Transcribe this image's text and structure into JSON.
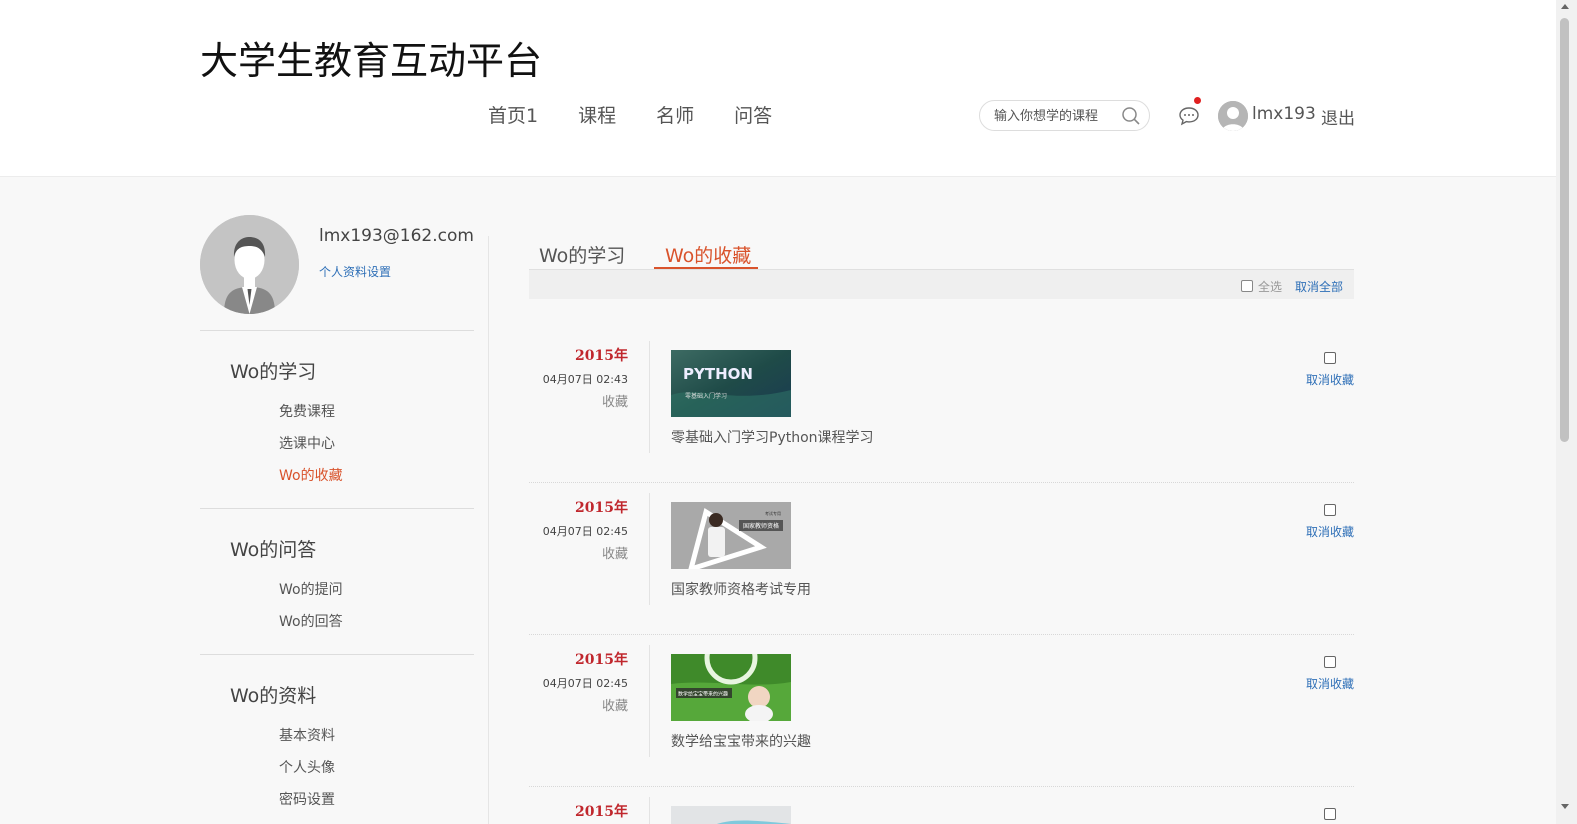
{
  "header": {
    "site_title": "大学生教育互动平台",
    "nav": [
      "首页1",
      "课程",
      "名师",
      "问答"
    ],
    "search_placeholder": "输入你想学的课程",
    "username": "lmx193",
    "logout": "退出"
  },
  "profile": {
    "email": "lmx193@162.com",
    "settings_link": "个人资料设置"
  },
  "sidebar": {
    "sections": [
      {
        "title": "Wo的学习",
        "items": [
          "免费课程",
          "选课中心",
          "Wo的收藏"
        ],
        "active_index": 2
      },
      {
        "title": "Wo的问答",
        "items": [
          "Wo的提问",
          "Wo的回答"
        ]
      },
      {
        "title": "Wo的资料",
        "items": [
          "基本资料",
          "个人头像",
          "密码设置"
        ]
      }
    ]
  },
  "tabs": [
    "Wo的学习",
    "Wo的收藏"
  ],
  "active_tab": 1,
  "toolbar": {
    "select_all": "全选",
    "cancel_all": "取消全部"
  },
  "favorites": [
    {
      "year": "2015年",
      "date": "04月07日  02:43",
      "action": "收藏",
      "title": "零基础入门学习Python课程学习",
      "uncollect": "取消收藏",
      "thumb_text": "PYTHON",
      "thumb_sub": "零基础入门学习"
    },
    {
      "year": "2015年",
      "date": "04月07日  02:45",
      "action": "收藏",
      "title": "国家教师资格考试专用",
      "uncollect": "取消收藏",
      "thumb_text": "国家教师资格",
      "thumb_sub": "考试专用"
    },
    {
      "year": "2015年",
      "date": "04月07日  02:45",
      "action": "收藏",
      "title": "数学给宝宝带来的兴趣",
      "uncollect": "取消收藏",
      "thumb_text": "数学给宝宝带来的兴趣",
      "thumb_sub": ""
    },
    {
      "year": "2015年"
    }
  ],
  "colors": {
    "accent": "#d9532c",
    "link": "#2e6fb7",
    "year": "#c0272d"
  }
}
